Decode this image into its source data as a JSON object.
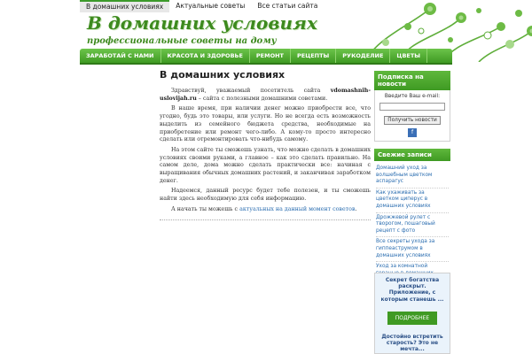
{
  "topnav": [
    "В домашних условиях",
    "Актуальные советы",
    "Все статьи сайта"
  ],
  "header": {
    "title": "В домашних условиях",
    "subtitle": "профессиональные советы на дому"
  },
  "mainmenu": [
    "ЗАРАБОТАЙ С НАМИ",
    "КРАСОТА И ЗДОРОВЬЕ",
    "РЕМОНТ",
    "РЕЦЕПТЫ",
    "РУКОДЕЛИЕ",
    "ЦВЕТЫ"
  ],
  "content": {
    "heading": "В домашних условиях",
    "p1_a": "Здравствуй, уважаемый посетитель сайта ",
    "p1_site": "vdomashnih-uslovijah.ru",
    "p1_b": " – сайта с полезными домашними советами.",
    "p2": "В наше время, при наличии денег можно приобрести все, что угодно, будь это товары, или услуги. Но не всегда есть возможность выделить из семейного бюджета средства, необходимые на приобретение или ремонт чего-либо. А кому-то просто интересно сделать или отремонтировать что-нибудь самому.",
    "p3": "На этом сайте ты сможешь узнать, что можно сделать в домашних условиях своими руками, а главное – как это сделать правильно. На самом деле, дома можно сделать практически все: начиная с выращивания обычных домашних растений, и заканчивая заработком денег.",
    "p4": "Надеемся, данный ресурс будет тебе полезен, и ты сможешь найти здесь необходимую для себя информацию.",
    "p5_a": "А начать ты можешь с ",
    "p5_link": "актуальных на данный момент советов",
    "p5_b": "."
  },
  "sidebar": {
    "subscribe_title": "Подписка на новости",
    "email_label": "Введите Ваш e-mail:",
    "email_value": "",
    "subscribe_button": "Получить новости",
    "feed_icon_glyph": "f",
    "recent_title": "Свежие записи",
    "recent": [
      "Домашний уход за волшебным цветком аспарагус",
      "Как ухаживать за цветком циперус в домашних условиях",
      "Дрожжевой рулет с творогом, пошаговый рецепт с фото",
      "Все секреты ухода за гиппеаструмом в домашних условиях",
      "Уход за комнатной геранью в домашних условиях"
    ]
  },
  "ad": {
    "title": "Секрет богатства раскрыт. Приложение, с которым станешь ...",
    "button": "ПОДРОБНЕЕ",
    "title2": "Достойно встретить старость? Это не мечта..."
  },
  "colors": {
    "accent": "#3f9a23",
    "title": "#3d8a1e",
    "link": "#2a6db0"
  }
}
